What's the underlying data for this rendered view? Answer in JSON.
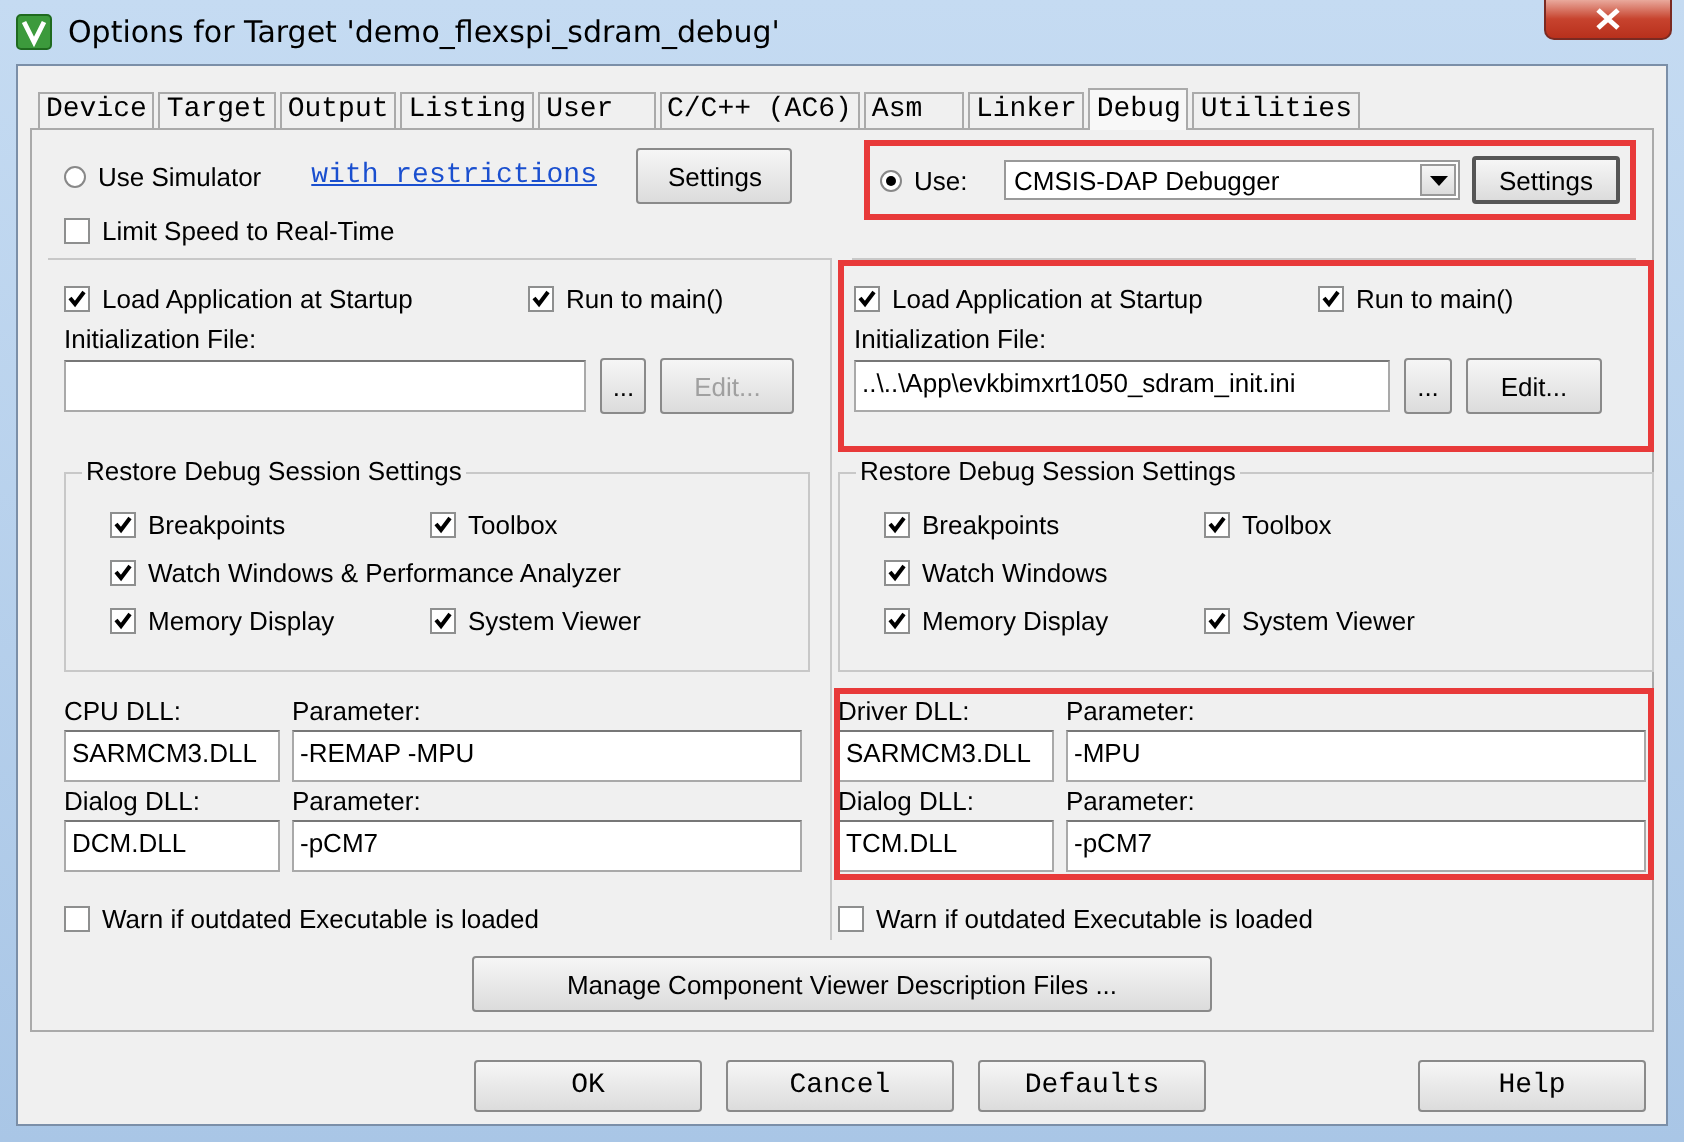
{
  "window": {
    "title": "Options for Target 'demo_flexspi_sdram_debug'"
  },
  "tabs": [
    {
      "label": "Device",
      "selected": false
    },
    {
      "label": "Target",
      "selected": false
    },
    {
      "label": "Output",
      "selected": false
    },
    {
      "label": "Listing",
      "selected": false
    },
    {
      "label": "User  ",
      "selected": false
    },
    {
      "label": "C/C++ (AC6)",
      "selected": false
    },
    {
      "label": "Asm  ",
      "selected": false
    },
    {
      "label": "Linker",
      "selected": false
    },
    {
      "label": "Debug",
      "selected": true
    },
    {
      "label": "Utilities",
      "selected": false
    }
  ],
  "simulator": {
    "label": "Use Simulator",
    "selected": false,
    "link": "with restrictions",
    "settings_button": "Settings",
    "limit_speed": {
      "label": "Limit Speed to Real-Time",
      "checked": false
    }
  },
  "target": {
    "label": "Use:",
    "selected": true,
    "debugger": "CMSIS-DAP Debugger",
    "settings_button": "Settings",
    "highlighted": true
  },
  "columns": [
    {
      "load_app": {
        "label": "Load Application at Startup",
        "checked": true
      },
      "run_to_main": {
        "label": "Run to main()",
        "checked": true
      },
      "init_label": "Initialization File:",
      "browse_button": "...",
      "edit_button": {
        "label": "Edit...",
        "disabled": true
      },
      "load_highlighted": false,
      "restore": {
        "title": "Restore Debug Session Settings",
        "items": [
          {
            "label": "Breakpoints",
            "checked": true
          },
          {
            "label": "Toolbox",
            "checked": true
          },
          {
            "label": "Watch Windows & Performance Analyzer",
            "checked": true
          },
          {
            "label": "Memory Display",
            "checked": true
          },
          {
            "label": "System Viewer",
            "checked": true
          }
        ]
      },
      "dll": [
        {
          "label": "CPU DLL:",
          "value": "SARMCM3.DLL",
          "param_label": "Parameter:",
          "param_value": "-REMAP -MPU"
        },
        {
          "label": "Dialog DLL:",
          "value": "DCM.DLL",
          "param_label": "Parameter:",
          "param_value": "-pCM7"
        }
      ],
      "dll_highlighted": false,
      "warn": {
        "label": "Warn if outdated Executable is loaded",
        "checked": false
      }
    },
    {
      "load_app": {
        "label": "Load Application at Startup",
        "checked": true
      },
      "run_to_main": {
        "label": "Run to main()",
        "checked": true
      },
      "init_label": "Initialization File:",
      "init_value": "..\\..\\App\\evkbimxrt1050_sdram_init.ini",
      "browse_button": "...",
      "edit_button": {
        "label": "Edit...",
        "disabled": false
      },
      "load_highlighted": true,
      "restore": {
        "title": "Restore Debug Session Settings",
        "items": [
          {
            "label": "Breakpoints",
            "checked": true
          },
          {
            "label": "Toolbox",
            "checked": true
          },
          {
            "label": "Watch Windows",
            "checked": true
          },
          {
            "label": "Memory Display",
            "checked": true
          },
          {
            "label": "System Viewer",
            "checked": true
          }
        ]
      },
      "dll": [
        {
          "label": "Driver DLL:",
          "value": "SARMCM3.DLL",
          "param_label": "Parameter:",
          "param_value": "-MPU"
        },
        {
          "label": "Dialog DLL:",
          "value": "TCM.DLL",
          "param_label": "Parameter:",
          "param_value": "-pCM7"
        }
      ],
      "dll_highlighted": true,
      "warn": {
        "label": "Warn if outdated Executable is loaded",
        "checked": false
      }
    }
  ],
  "manage_button": "Manage Component Viewer Description Files ...",
  "buttons": [
    "OK",
    "Cancel",
    "Defaults",
    "Help"
  ]
}
